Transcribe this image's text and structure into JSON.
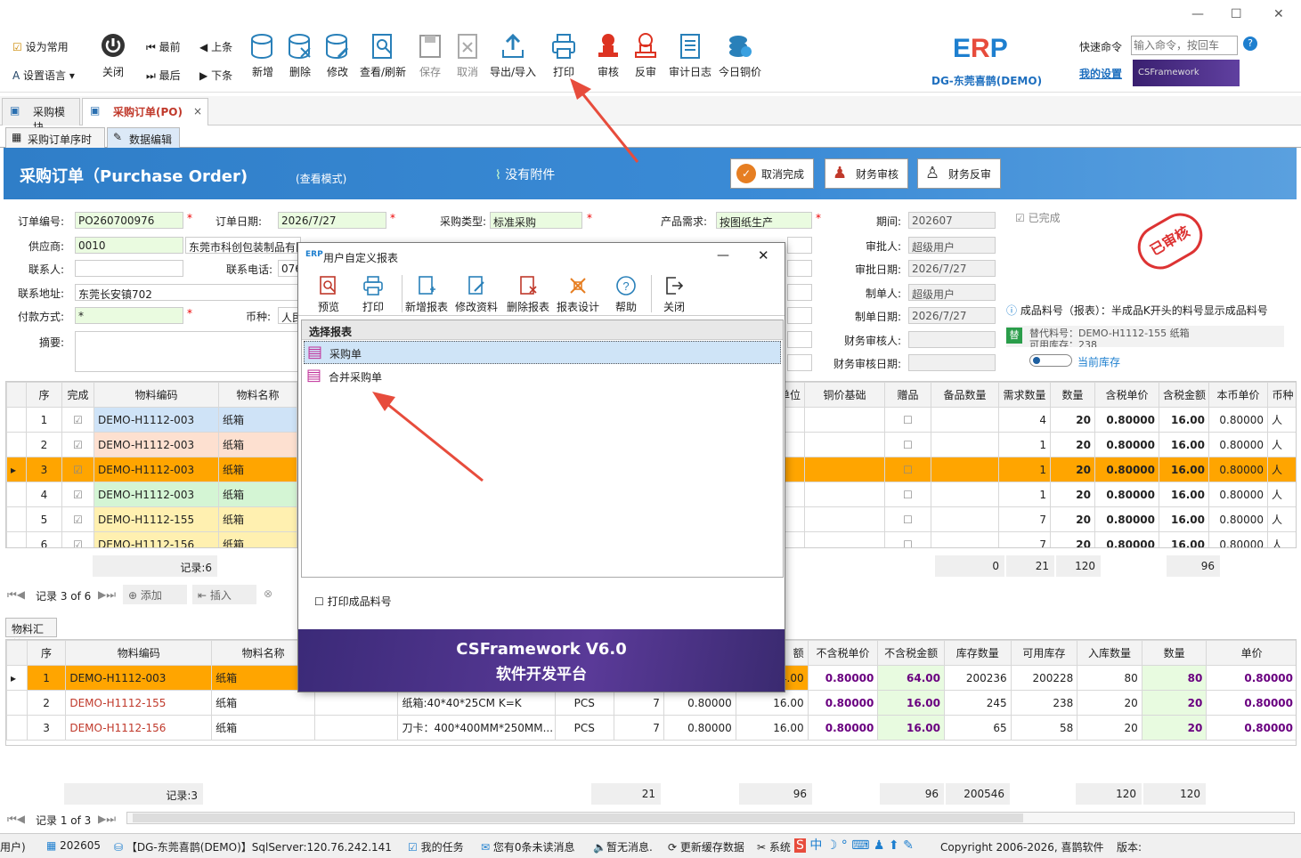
{
  "toolbar": {
    "set_common": "设为常用",
    "set_lang": "设置语言",
    "close": "关闭",
    "first": "最前",
    "last": "最后",
    "prev": "上条",
    "next": "下条",
    "buttons": [
      "新增",
      "删除",
      "修改",
      "查看/刷新",
      "保存",
      "取消",
      "导出/导入",
      "打印",
      "审核",
      "反审",
      "审计日志",
      "今日铜价"
    ],
    "brand": "DG-东莞喜鹊(DEMO)",
    "quick_cmd_label": "快速命令",
    "quick_cmd_placeholder": "输入命令，按回车",
    "my_settings": "我的设置",
    "csf_logo": "CSFramework"
  },
  "tabs": [
    "采购模块",
    "采购订单(PO)"
  ],
  "subtabs": [
    "采购订单序时簿",
    "数据编辑"
  ],
  "banner": {
    "title": "采购订单（Purchase Order)",
    "mode": "(查看模式)",
    "attach": "没有附件",
    "btn_cancel_done": "取消完成",
    "btn_fin_audit": "财务审核",
    "btn_fin_unaudit": "财务反审"
  },
  "form": {
    "order_no_label": "订单编号:",
    "order_no": "PO260700976",
    "order_date_label": "订单日期:",
    "order_date": "2026/7/27",
    "purchase_type_label": "采购类型:",
    "purchase_type": "标准采购",
    "product_req_label": "产品需求:",
    "product_req": "按图纸生产",
    "period_label": "期间:",
    "period": "202607",
    "completed_label": "已完成",
    "supplier_label": "供应商:",
    "supplier_code": "0010",
    "supplier_name": "东莞市科创包装制品有限公司",
    "contact_label": "联系人:",
    "phone_label": "联系电话:",
    "phone": "076",
    "address_label": "联系地址:",
    "address": "东莞长安镇702",
    "pay_label": "付款方式:",
    "pay": "*",
    "currency_label": "币种:",
    "currency": "人民",
    "remark_label": "摘要:",
    "approver_label": "审批人:",
    "approver": "超级用户",
    "approve_date_label": "审批日期:",
    "approve_date": "2026/7/27",
    "maker_label": "制单人:",
    "maker": "超级用户",
    "make_date_label": "制单日期:",
    "make_date": "2026/7/27",
    "fin_auditor_label": "财务审核人:",
    "fin_audit_date_label": "财务审核日期:",
    "stamp": "已审核",
    "hint": "成品料号（报表）：半成品K开头的料号显示成品料号",
    "sub_code": "替代料号：DEMO-H1112-155 纸箱",
    "avail_stock": "可用库存：238",
    "sub_tag": "替",
    "current_stock": "当前库存"
  },
  "grid1": {
    "headers": [
      "序",
      "完成",
      "物料编码",
      "物料名称",
      "单位",
      "铜价基础",
      "赠品",
      "备品数量",
      "需求数量",
      "数量",
      "含税单价",
      "含税金额",
      "本币单价",
      "币种"
    ],
    "rows": [
      {
        "no": "1",
        "code": "DEMO-H1112-003",
        "name": "纸箱",
        "req": "4",
        "qty": "20",
        "price": "0.80000",
        "amt": "16.00",
        "lprice": "0.80000",
        "cur": "人",
        "color": "#cfe3f7"
      },
      {
        "no": "2",
        "code": "DEMO-H1112-003",
        "name": "纸箱",
        "req": "1",
        "qty": "20",
        "price": "0.80000",
        "amt": "16.00",
        "lprice": "0.80000",
        "cur": "人",
        "color": "#fde0d0"
      },
      {
        "no": "3",
        "code": "DEMO-H1112-003",
        "name": "纸箱",
        "req": "1",
        "qty": "20",
        "price": "0.80000",
        "amt": "16.00",
        "lprice": "0.80000",
        "cur": "人",
        "color": "#ffa500"
      },
      {
        "no": "4",
        "code": "DEMO-H1112-003",
        "name": "纸箱",
        "req": "1",
        "qty": "20",
        "price": "0.80000",
        "amt": "16.00",
        "lprice": "0.80000",
        "cur": "人",
        "color": "#d4f5d4"
      },
      {
        "no": "5",
        "code": "DEMO-H1112-155",
        "name": "纸箱",
        "req": "7",
        "qty": "20",
        "price": "0.80000",
        "amt": "16.00",
        "lprice": "0.80000",
        "cur": "人",
        "color": "#fff0b0"
      },
      {
        "no": "6",
        "code": "DEMO-H1112-156",
        "name": "纸箱",
        "req": "7",
        "qty": "20",
        "price": "0.80000",
        "amt": "16.00",
        "lprice": "0.80000",
        "cur": "人",
        "color": "#fff0b0"
      }
    ],
    "records": "记录:6",
    "sum_spare": "0",
    "sum_req": "21",
    "sum_qty": "120",
    "sum_amt": "96",
    "nav_text": "记录 3 of 6",
    "add": "添加",
    "insert": "插入"
  },
  "summary_tab": "物料汇总",
  "grid2": {
    "headers": [
      "序",
      "物料编码",
      "物料名称",
      "",
      "",
      "",
      "",
      "",
      "额",
      "不含税单价",
      "不含税金额",
      "库存数量",
      "可用库存",
      "入库数量",
      "数量",
      "单价"
    ],
    "rows": [
      {
        "no": "1",
        "code": "DEMO-H1112-003",
        "name": "纸箱",
        "spec": "",
        "unit": "",
        "q": "",
        "p": "",
        "amt": "4.00",
        "np": "0.80000",
        "na": "64.00",
        "stock": "200236",
        "avail": "200228",
        "in": "80",
        "qty": "80",
        "price": "0.80000"
      },
      {
        "no": "2",
        "code": "DEMO-H1112-155",
        "name": "纸箱",
        "spec": "纸箱:40*40*25CM K=K",
        "unit": "PCS",
        "q": "7",
        "p": "0.80000",
        "amt": "16.00",
        "np": "0.80000",
        "na": "16.00",
        "stock": "245",
        "avail": "238",
        "in": "20",
        "qty": "20",
        "price": "0.80000"
      },
      {
        "no": "3",
        "code": "DEMO-H1112-156",
        "name": "纸箱",
        "spec": "刀卡：400*400MM*250MM...",
        "unit": "PCS",
        "q": "7",
        "p": "0.80000",
        "amt": "16.00",
        "np": "0.80000",
        "na": "16.00",
        "stock": "65",
        "avail": "58",
        "in": "20",
        "qty": "20",
        "price": "0.80000"
      }
    ],
    "records": "记录:3",
    "s1": "21",
    "s2": "96",
    "s3": "96",
    "s4": "200546",
    "s5": "120",
    "s6": "120",
    "nav_text": "记录 1 of 3"
  },
  "dialog": {
    "title": "用户自定义报表",
    "buttons": [
      "预览",
      "打印",
      "新增报表",
      "修改资料",
      "删除报表",
      "报表设计",
      "帮助",
      "关闭"
    ],
    "list_header": "选择报表",
    "items": [
      "采购单",
      "合并采购单"
    ],
    "checkbox": "打印成品料号",
    "footer_brand": "CSFramework V6.0",
    "footer_sub": "软件开发平台"
  },
  "status": {
    "user": "用户)",
    "period": "202605",
    "db": "【DG-东莞喜鹊(DEMO)】SqlServer:120.76.242.141",
    "tasks": "我的任务",
    "unread": "您有0条未读消息",
    "nomsg": "暂无消息.",
    "cache": "更新缓存数据",
    "sys": "系统",
    "copyright": "Copyright 2006-2026, 喜鹊软件",
    "version": "版本:"
  }
}
